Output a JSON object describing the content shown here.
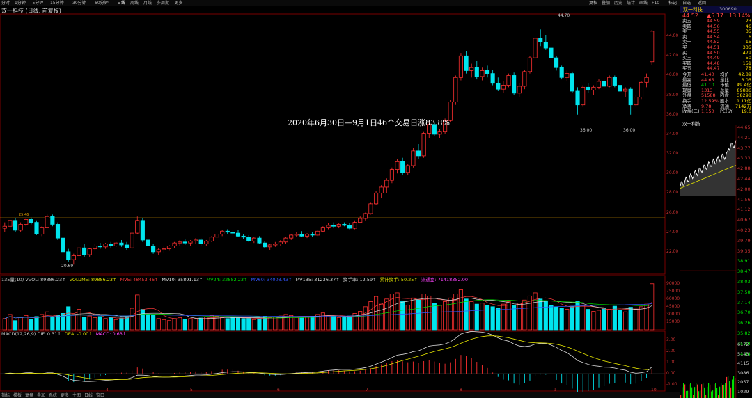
{
  "toolbar": {
    "tabs": [
      "分时",
      "1分钟",
      "5分钟",
      "15分钟",
      "30分钟",
      "60分钟",
      "日线",
      "周线",
      "月线",
      "多周期",
      "更多"
    ],
    "active_tab": "日线",
    "right_tabs": [
      "复权",
      "叠加",
      "历史",
      "统计",
      "画线",
      "F10",
      "标记",
      "-自选",
      "返回"
    ]
  },
  "title": "双一科技 (日线, 前复权)",
  "annotation": "2020年6月30日—9月1日46个交易日涨83.8%",
  "price_labels": {
    "high": "44.70",
    "low": "20.69",
    "low2a": "36.00",
    "low2b": "36.00",
    "ref": "25.46"
  },
  "price_axis": [
    "44.00",
    "42.00",
    "40.00",
    "38.00",
    "36.00",
    "34.00",
    "32.00",
    "30.00",
    "28.00",
    "26.00",
    "24.00",
    "22.00"
  ],
  "volume_axis": [
    "90000",
    "75000",
    "60000",
    "45000",
    "30000",
    "15000"
  ],
  "macd_axis": [
    "3.00",
    "2.00",
    "1.00",
    "0.00",
    "-1.00"
  ],
  "x_labels": [
    "4",
    "5",
    "6",
    "7",
    "8",
    "9",
    "10"
  ],
  "indicators": {
    "vol_line": [
      {
        "text": "135量(10) VVOL: 89886.23↑",
        "color": "#ccc"
      },
      {
        "text": "VOLUME: 89886.23↑",
        "color": "#e6e600"
      },
      {
        "text": "MV5: 48453.46↑",
        "color": "#ff3b3b"
      },
      {
        "text": "MV10: 35891.13↑",
        "color": "#ddd"
      },
      {
        "text": "MV24: 32882.23↑",
        "color": "#00e000"
      },
      {
        "text": "MV60: 34003.43↑",
        "color": "#3355ff"
      },
      {
        "text": "MV135: 31236.37↑",
        "color": "#ddd"
      },
      {
        "text": "换手率: 12.59↑",
        "color": "#ddd"
      },
      {
        "text": "累计换手: 50.25↑",
        "color": "#e6e600"
      },
      {
        "text": "流通盘: 71418352.00",
        "color": "#ff44ff"
      }
    ],
    "macd_line": [
      {
        "text": "MACD(12,26,9) DIF: 0.31↑",
        "color": "#ccc"
      },
      {
        "text": "DEA: -0.00↑",
        "color": "#e6e600"
      },
      {
        "text": "MACD: 0.63↑",
        "color": "#ff44ff"
      }
    ]
  },
  "quote": {
    "name": "双一科技",
    "code": "300690",
    "price": "44.52",
    "change": "▲5.17",
    "pct": "13.14%",
    "sell": [
      {
        "label": "卖五",
        "price": "44.59",
        "vol": "23"
      },
      {
        "label": "卖四",
        "price": "44.56",
        "vol": "46"
      },
      {
        "label": "卖三",
        "price": "44.55",
        "vol": "35"
      },
      {
        "label": "卖二",
        "price": "44.54",
        "vol": "6"
      },
      {
        "label": "卖一",
        "price": "44.52",
        "vol": "15"
      }
    ],
    "buy": [
      {
        "label": "买一",
        "price": "44.51",
        "vol": "335"
      },
      {
        "label": "买二",
        "price": "44.50",
        "vol": "479"
      },
      {
        "label": "买三",
        "price": "44.49",
        "vol": "50"
      },
      {
        "label": "买四",
        "price": "44.48",
        "vol": "151"
      },
      {
        "label": "买五",
        "price": "44.47",
        "vol": "78"
      }
    ],
    "stats": [
      {
        "l1": "今开",
        "v1": "41.40",
        "l2": "均价",
        "v2": "42.89"
      },
      {
        "l1": "最高",
        "v1": "44.65",
        "l2": "量比",
        "v2": "3.05"
      },
      {
        "l1": "最低",
        "v1": "41.10",
        "l2": "市值",
        "v2": "49.4亿"
      },
      {
        "l1": "现量",
        "v1": "1313",
        "l2": "总量",
        "v2": "89886"
      },
      {
        "l1": "外盘",
        "v1": "51588",
        "l2": "内盘",
        "v2": "38298"
      },
      {
        "l1": "换手",
        "v1": "12.59%",
        "l2": "股本",
        "v2": "1.11亿"
      },
      {
        "l1": "净资",
        "v1": "9.78",
        "l2": "流通",
        "v2": "7142万"
      },
      {
        "l1": "收益(二)",
        "v1": "1.150",
        "l2": "PE(动)",
        "v2": "19.6"
      }
    ],
    "mini_title": "双一科技",
    "mini_axis_price": [
      "44.65",
      "44.21",
      "43.77",
      "43.33",
      "42.88",
      "42.44",
      "42.00",
      "41.56",
      "41.12",
      "40.67",
      "40.23",
      "39.79",
      "39.35",
      "38.91",
      "38.47",
      "38.03",
      "37.58",
      "37.14",
      "36.70",
      "36.26",
      "35.82",
      "35.38",
      "34.94"
    ],
    "mini_axis_vol": [
      "6172",
      "5143",
      "4115",
      "3086",
      "2057",
      "1029"
    ]
  },
  "bottom": {
    "tabs": [
      "指标",
      "模板",
      "复盘",
      "叠加",
      "系统",
      "更多",
      "主图",
      "日线",
      "窗口"
    ]
  },
  "chart_data": {
    "type": "candlestick",
    "title": "双一科技 (日线, 前复权)",
    "ylim": [
      20,
      46
    ],
    "candles": [
      [
        24.4,
        25.0,
        24.0,
        24.6
      ],
      [
        24.6,
        25.4,
        24.4,
        25.2
      ],
      [
        25.2,
        25.4,
        24.0,
        24.2
      ],
      [
        24.2,
        25.0,
        24.0,
        24.8
      ],
      [
        24.8,
        25.5,
        24.6,
        25.3
      ],
      [
        25.3,
        25.5,
        24.8,
        25.0
      ],
      [
        25.0,
        25.2,
        23.7,
        23.8
      ],
      [
        23.8,
        24.6,
        23.6,
        24.5
      ],
      [
        24.5,
        25.8,
        24.4,
        25.6
      ],
      [
        25.6,
        25.8,
        24.6,
        24.8
      ],
      [
        24.8,
        25.0,
        23.2,
        23.4
      ],
      [
        23.4,
        23.6,
        21.8,
        22.0
      ],
      [
        22.0,
        22.3,
        21.0,
        21.2
      ],
      [
        21.2,
        21.8,
        20.69,
        21.6
      ],
      [
        21.6,
        22.6,
        21.4,
        22.4
      ],
      [
        22.4,
        22.8,
        21.5,
        21.7
      ],
      [
        21.7,
        22.4,
        21.5,
        22.3
      ],
      [
        22.3,
        22.8,
        22.1,
        22.6
      ],
      [
        22.6,
        22.9,
        22.3,
        22.5
      ],
      [
        22.5,
        22.9,
        22.3,
        22.8
      ],
      [
        22.8,
        23.0,
        22.4,
        22.6
      ],
      [
        22.6,
        23.0,
        22.5,
        22.9
      ],
      [
        22.9,
        23.2,
        22.5,
        22.7
      ],
      [
        22.7,
        23.0,
        22.2,
        22.4
      ],
      [
        22.4,
        24.0,
        22.3,
        23.9
      ],
      [
        23.9,
        25.6,
        23.8,
        25.2
      ],
      [
        25.2,
        25.4,
        23.0,
        23.2
      ],
      [
        23.2,
        23.4,
        22.5,
        22.6
      ],
      [
        22.6,
        22.8,
        21.8,
        22.0
      ],
      [
        22.0,
        22.4,
        21.7,
        22.2
      ],
      [
        22.2,
        22.6,
        21.9,
        22.3
      ],
      [
        22.3,
        22.7,
        22.1,
        22.6
      ],
      [
        22.6,
        23.0,
        22.4,
        22.9
      ],
      [
        22.9,
        23.2,
        22.6,
        23.0
      ],
      [
        23.0,
        23.3,
        22.7,
        22.9
      ],
      [
        22.9,
        23.2,
        22.6,
        23.1
      ],
      [
        23.1,
        23.4,
        22.8,
        23.2
      ],
      [
        23.2,
        23.4,
        22.6,
        22.8
      ],
      [
        22.8,
        23.2,
        22.6,
        23.1
      ],
      [
        23.1,
        23.6,
        23.0,
        23.5
      ],
      [
        23.5,
        23.9,
        23.3,
        23.8
      ],
      [
        23.8,
        24.2,
        23.6,
        24.1
      ],
      [
        24.1,
        24.3,
        23.8,
        24.0
      ],
      [
        24.0,
        24.2,
        23.7,
        23.9
      ],
      [
        23.9,
        24.2,
        23.5,
        23.6
      ],
      [
        23.6,
        23.8,
        23.3,
        23.5
      ],
      [
        23.5,
        23.7,
        23.0,
        23.1
      ],
      [
        23.1,
        23.5,
        22.9,
        23.4
      ],
      [
        23.4,
        23.6,
        22.8,
        22.9
      ],
      [
        22.9,
        23.1,
        22.4,
        22.5
      ],
      [
        22.5,
        22.8,
        22.2,
        22.7
      ],
      [
        22.7,
        23.0,
        22.5,
        22.8
      ],
      [
        22.8,
        23.2,
        22.6,
        23.0
      ],
      [
        23.0,
        23.5,
        22.8,
        23.4
      ],
      [
        23.4,
        23.8,
        23.2,
        23.7
      ],
      [
        23.7,
        24.0,
        23.5,
        23.8
      ],
      [
        23.8,
        24.1,
        23.5,
        23.6
      ],
      [
        23.6,
        23.9,
        23.4,
        23.8
      ],
      [
        23.8,
        24.0,
        23.5,
        23.7
      ],
      [
        23.7,
        24.2,
        23.6,
        24.1
      ],
      [
        24.1,
        24.6,
        24.0,
        24.5
      ],
      [
        24.5,
        24.9,
        24.3,
        24.7
      ],
      [
        24.7,
        25.0,
        24.4,
        24.6
      ],
      [
        24.6,
        24.9,
        24.4,
        24.8
      ],
      [
        24.8,
        25.0,
        24.6,
        24.7
      ],
      [
        24.7,
        24.9,
        24.3,
        24.4
      ],
      [
        24.4,
        25.2,
        24.3,
        25.0
      ],
      [
        25.0,
        25.6,
        24.9,
        25.4
      ],
      [
        25.4,
        26.0,
        25.2,
        25.9
      ],
      [
        25.9,
        27.0,
        25.8,
        26.9
      ],
      [
        26.9,
        28.2,
        26.8,
        28.0
      ],
      [
        28.0,
        28.8,
        27.5,
        28.6
      ],
      [
        28.6,
        29.5,
        28.0,
        29.3
      ],
      [
        29.3,
        30.6,
        29.0,
        30.4
      ],
      [
        30.4,
        31.5,
        30.0,
        31.2
      ],
      [
        31.2,
        31.6,
        29.8,
        30.1
      ],
      [
        30.1,
        31.0,
        29.8,
        30.8
      ],
      [
        30.8,
        32.6,
        30.6,
        32.3
      ],
      [
        32.3,
        33.0,
        31.5,
        31.8
      ],
      [
        31.8,
        34.3,
        31.6,
        34.1
      ],
      [
        34.1,
        35.2,
        33.6,
        35.0
      ],
      [
        35.0,
        35.2,
        33.8,
        34.0
      ],
      [
        34.0,
        34.5,
        33.6,
        34.3
      ],
      [
        34.3,
        35.6,
        34.0,
        35.4
      ],
      [
        35.4,
        37.5,
        35.2,
        37.3
      ],
      [
        37.3,
        40.0,
        37.0,
        39.8
      ],
      [
        39.8,
        42.3,
        39.5,
        42.0
      ],
      [
        42.0,
        42.5,
        40.2,
        40.5
      ],
      [
        40.5,
        41.2,
        39.8,
        40.8
      ],
      [
        40.8,
        41.5,
        39.6,
        39.9
      ],
      [
        39.9,
        40.8,
        39.5,
        40.5
      ],
      [
        40.5,
        41.0,
        39.8,
        40.2
      ],
      [
        40.2,
        40.6,
        39.0,
        39.2
      ],
      [
        39.2,
        39.8,
        38.4,
        38.6
      ],
      [
        38.6,
        39.4,
        38.2,
        39.0
      ],
      [
        39.0,
        40.2,
        38.8,
        40.0
      ],
      [
        40.0,
        40.3,
        38.0,
        38.2
      ],
      [
        38.2,
        39.2,
        37.8,
        38.9
      ],
      [
        38.9,
        40.6,
        38.6,
        40.4
      ],
      [
        40.4,
        42.0,
        40.2,
        41.8
      ],
      [
        41.8,
        44.0,
        41.6,
        43.8
      ],
      [
        43.8,
        44.7,
        43.0,
        43.4
      ],
      [
        43.4,
        44.1,
        42.6,
        42.8
      ],
      [
        42.8,
        43.0,
        41.6,
        41.8
      ],
      [
        41.8,
        42.0,
        40.5,
        40.8
      ],
      [
        40.8,
        41.0,
        39.6,
        39.8
      ],
      [
        39.8,
        40.5,
        39.4,
        40.2
      ],
      [
        40.2,
        40.4,
        38.2,
        38.4
      ],
      [
        38.4,
        38.8,
        36.0,
        37.0
      ],
      [
        37.0,
        39.0,
        36.8,
        38.8
      ],
      [
        38.8,
        39.2,
        38.2,
        38.5
      ],
      [
        38.5,
        39.0,
        38.0,
        38.8
      ],
      [
        38.8,
        39.6,
        38.6,
        39.4
      ],
      [
        39.4,
        39.6,
        38.7,
        38.9
      ],
      [
        38.9,
        40.0,
        38.8,
        39.8
      ],
      [
        39.8,
        40.0,
        38.8,
        39.0
      ],
      [
        39.0,
        39.4,
        38.2,
        38.4
      ],
      [
        38.4,
        38.8,
        37.8,
        38.6
      ],
      [
        38.6,
        38.8,
        36.0,
        37.0
      ],
      [
        37.0,
        38.0,
        36.8,
        37.8
      ],
      [
        37.8,
        39.4,
        37.6,
        39.3
      ],
      [
        39.3,
        40.2,
        38.8,
        39.8
      ],
      [
        41.4,
        44.65,
        41.1,
        44.52
      ]
    ],
    "volumes": [
      22000,
      30000,
      18000,
      25000,
      28000,
      20000,
      26000,
      30000,
      35000,
      24000,
      28000,
      32000,
      45000,
      30000,
      40000,
      25000,
      27000,
      24000,
      26000,
      22000,
      24000,
      20000,
      23000,
      26000,
      42000,
      68000,
      40000,
      30000,
      28000,
      22000,
      20000,
      18000,
      22000,
      24000,
      20000,
      22000,
      21000,
      23000,
      25000,
      28000,
      26000,
      24000,
      22000,
      25000,
      23000,
      22000,
      24000,
      20000,
      22000,
      26000,
      24000,
      25000,
      27000,
      30000,
      28000,
      24000,
      23000,
      25000,
      26000,
      30000,
      33000,
      28000,
      26000,
      24000,
      25000,
      27000,
      32000,
      36000,
      45000,
      55000,
      65000,
      50000,
      60000,
      70000,
      72000,
      55000,
      48000,
      62000,
      58000,
      70000,
      66000,
      52000,
      48000,
      55000,
      62000,
      70000,
      78000,
      60000,
      55000,
      50000,
      52000,
      48000,
      45000,
      42000,
      50000,
      55000,
      48000,
      52000,
      58000,
      66000,
      72000,
      60000,
      55000,
      48000,
      45000,
      42000,
      40000,
      46000,
      55000,
      48000,
      40000,
      36000,
      38000,
      42000,
      40000,
      46000,
      38000,
      35000,
      44000,
      40000,
      45000,
      50000,
      89886
    ]
  }
}
